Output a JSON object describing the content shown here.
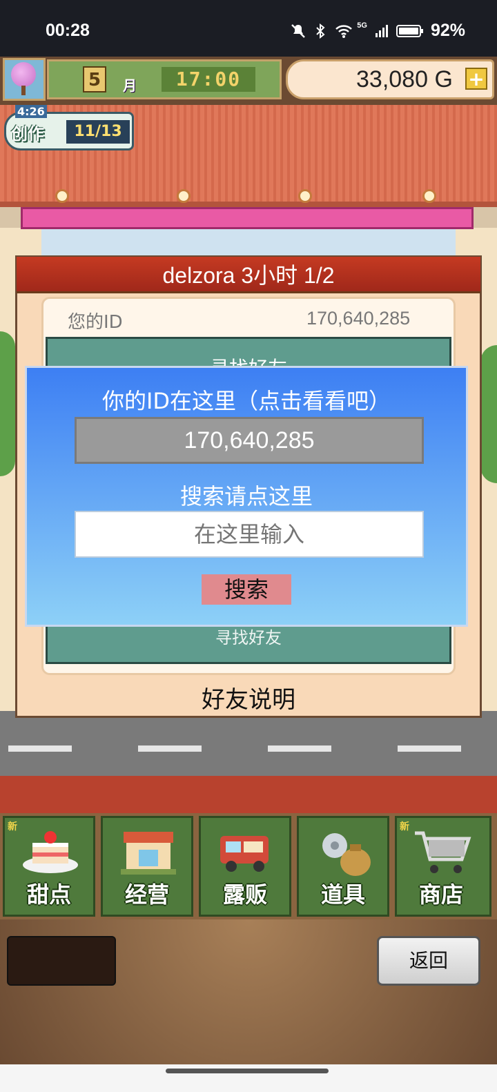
{
  "status_bar": {
    "time": "00:28",
    "signal_label": "5G",
    "battery": "92%",
    "icons": [
      "mute-icon",
      "bluetooth-icon",
      "wifi-icon",
      "signal-icon",
      "battery-icon"
    ]
  },
  "hud": {
    "month_number": "5",
    "month_label": "月",
    "clock": "17:00",
    "money": "33,080 G",
    "add_label": "+"
  },
  "create_badge": {
    "timer": "4:26",
    "label": "创作",
    "count": "11/13"
  },
  "dialog": {
    "title": "delzora  3小时 1/2",
    "your_id_label": "您的ID",
    "your_id_value": "170,640,285",
    "find_friend_top": "寻找好友",
    "find_friend_bottom": "寻找好友",
    "explain": "好友说明"
  },
  "overlay": {
    "title": "你的ID在这里（点击看看吧）",
    "id_value": "170,640,285",
    "search_label": "搜索请点这里",
    "input_placeholder": "在这里输入",
    "search_button": "搜索"
  },
  "nav": {
    "items": [
      {
        "label": "甜点",
        "new": "新"
      },
      {
        "label": "经营",
        "new": ""
      },
      {
        "label": "露贩",
        "new": ""
      },
      {
        "label": "道具",
        "new": ""
      },
      {
        "label": "商店",
        "new": "新"
      }
    ]
  },
  "bottom": {
    "back_label": "返回"
  },
  "colors": {
    "overlay_top": "#3d7ff3",
    "overlay_bottom": "#8dd0f7",
    "title_bar": "#c53a22",
    "nav_green": "#4f7a3c",
    "search_button": "#e08a8e"
  }
}
